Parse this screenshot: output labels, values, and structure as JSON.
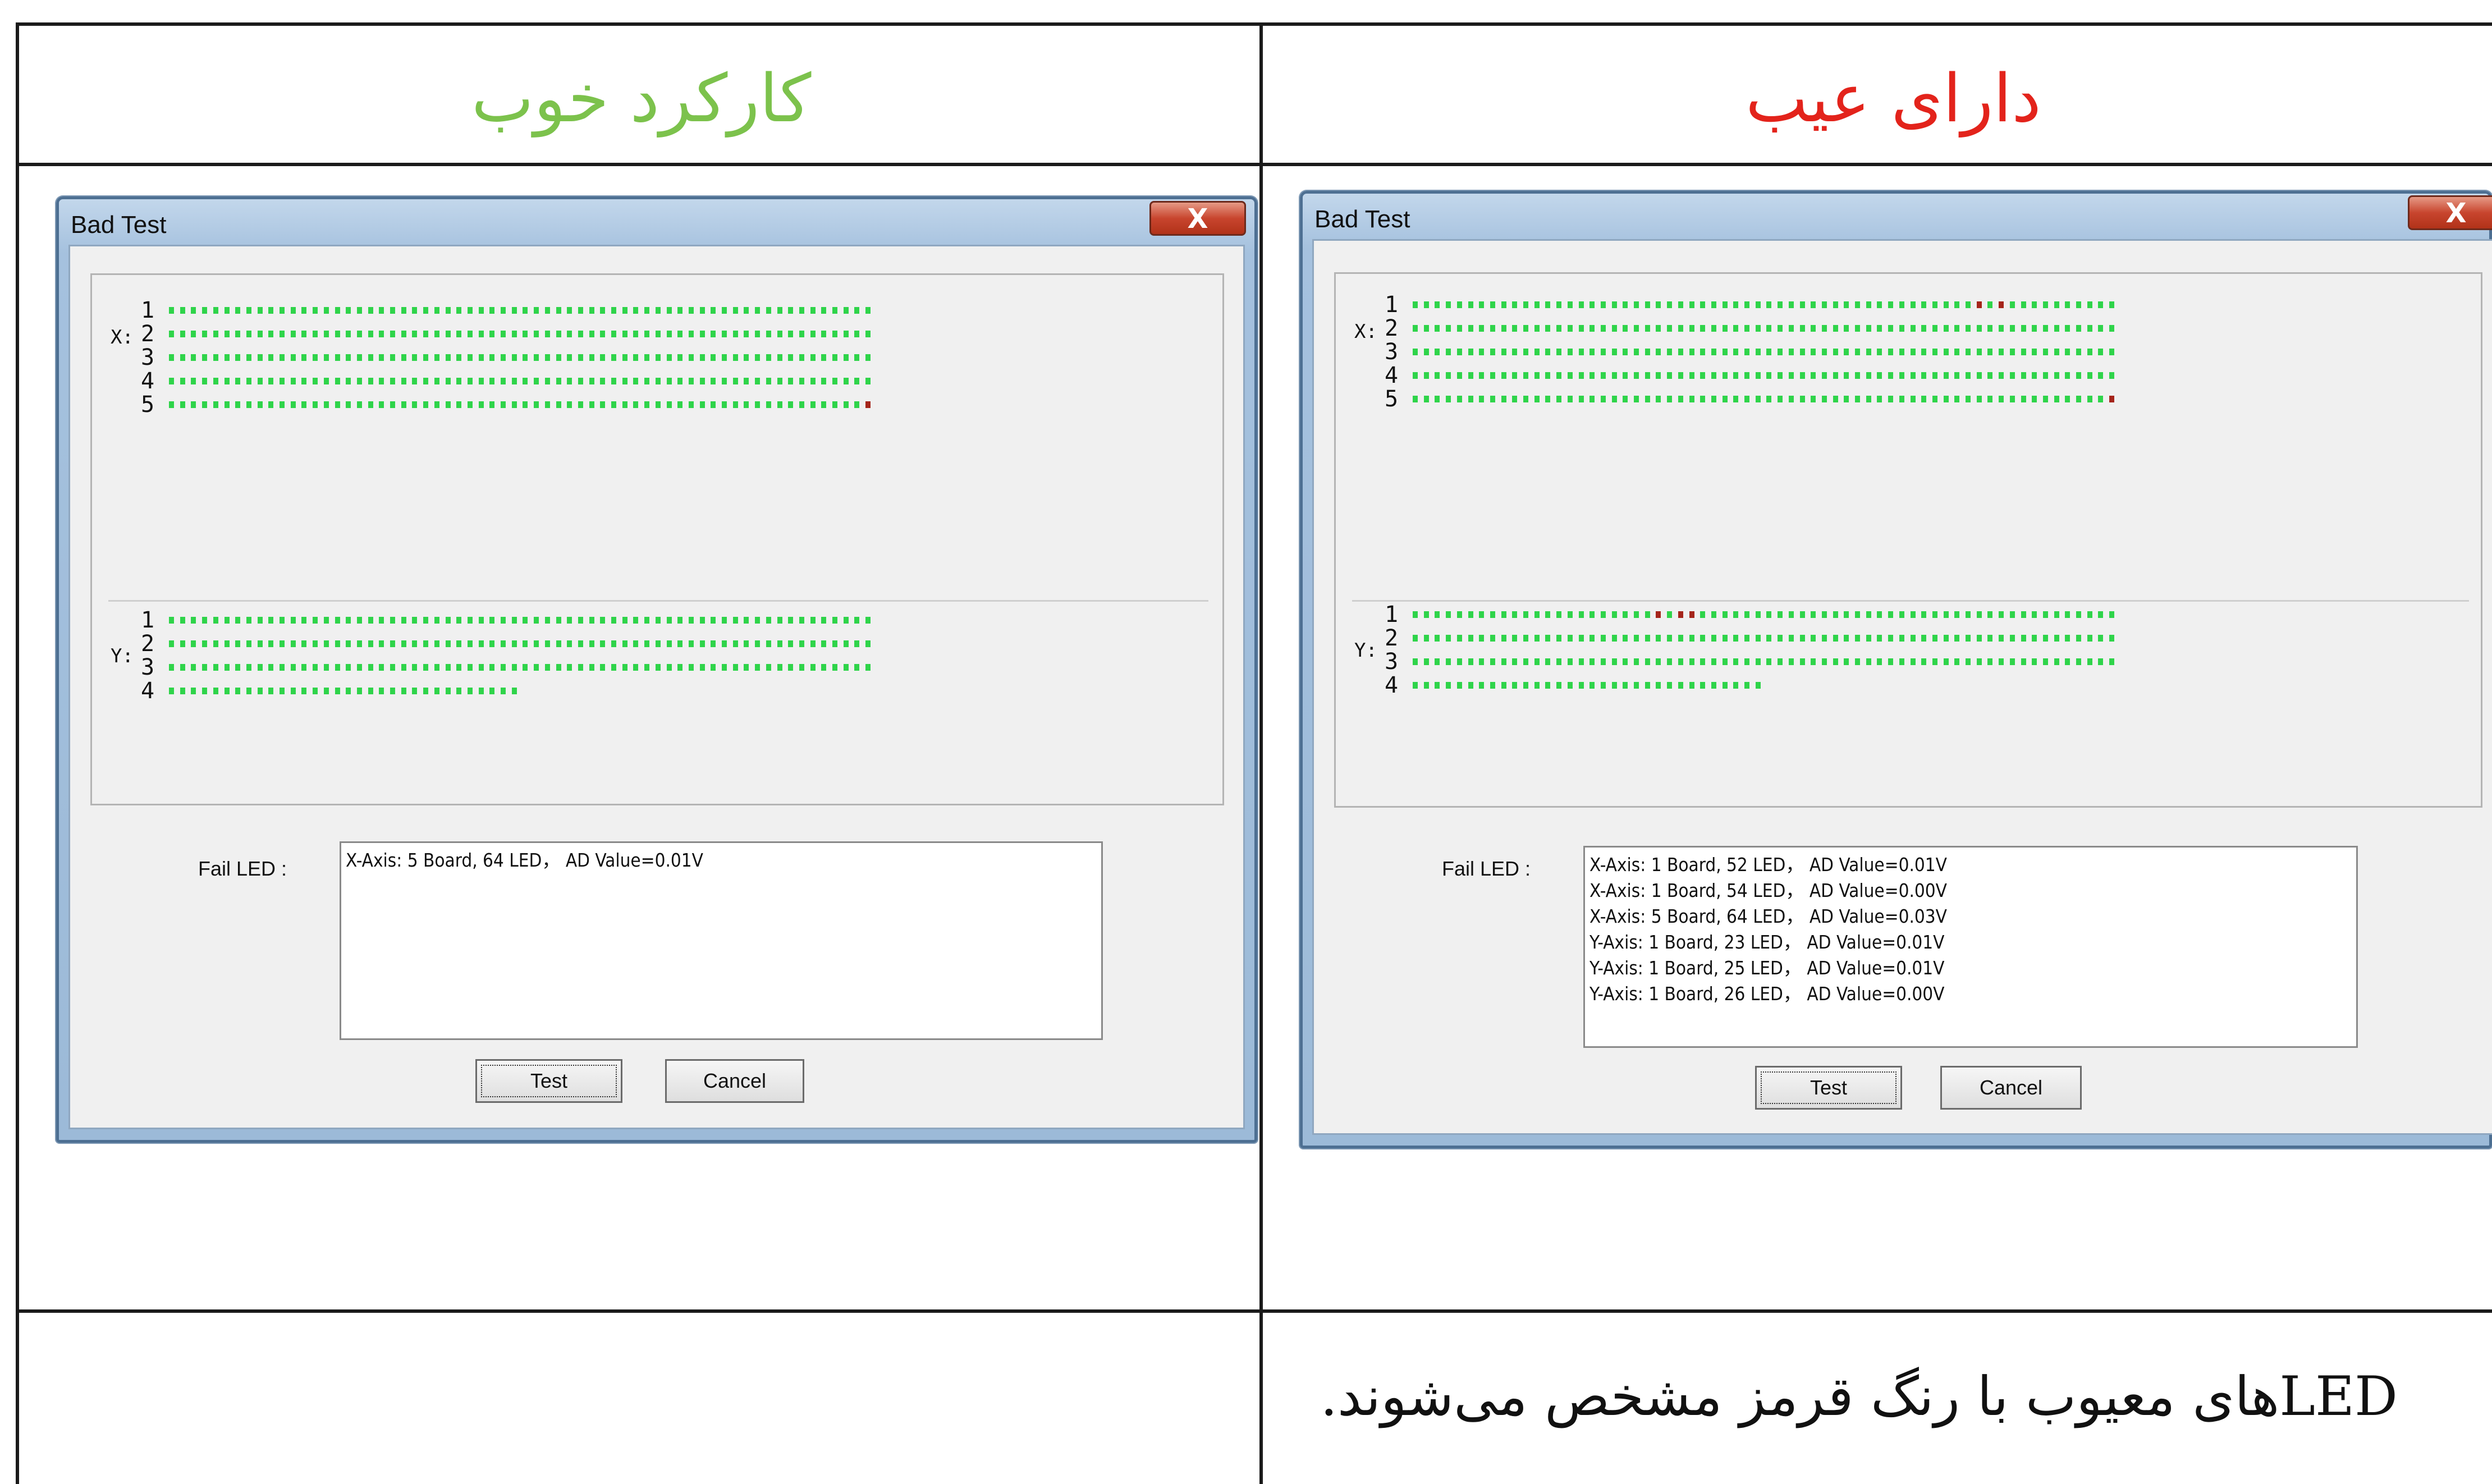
{
  "table": {
    "good_heading": "کارکرد خوب",
    "bad_heading": "دارای عیب",
    "note": "LEDهای معیوب با رنگ قرمز مشخص می‌شوند.",
    "colors": {
      "good_heading": "#7cc24c",
      "bad_heading": "#e3231b"
    }
  },
  "left_window": {
    "title": "Bad Test",
    "close_label": "X",
    "x_axis_label": "X:",
    "y_axis_label": "Y:",
    "x_rows": [
      {
        "label": "1",
        "count": 64,
        "bad": []
      },
      {
        "label": "2",
        "count": 64,
        "bad": []
      },
      {
        "label": "3",
        "count": 64,
        "bad": []
      },
      {
        "label": "4",
        "count": 64,
        "bad": []
      },
      {
        "label": "5",
        "count": 64,
        "bad": [
          64
        ]
      }
    ],
    "y_rows": [
      {
        "label": "1",
        "count": 64,
        "bad": []
      },
      {
        "label": "2",
        "count": 64,
        "bad": []
      },
      {
        "label": "3",
        "count": 64,
        "bad": []
      },
      {
        "label": "4",
        "count": 32,
        "bad": []
      }
    ],
    "fail_label": "Fail LED :",
    "fail_lines": [
      "X-Axis: 5 Board, 64 LED， AD Value=0.01V"
    ],
    "test_button": "Test",
    "cancel_button": "Cancel"
  },
  "right_window": {
    "title": "Bad Test",
    "close_label": "X",
    "x_axis_label": "X:",
    "y_axis_label": "Y:",
    "x_rows": [
      {
        "label": "1",
        "count": 64,
        "bad": [
          52,
          54
        ]
      },
      {
        "label": "2",
        "count": 64,
        "bad": []
      },
      {
        "label": "3",
        "count": 64,
        "bad": []
      },
      {
        "label": "4",
        "count": 64,
        "bad": []
      },
      {
        "label": "5",
        "count": 64,
        "bad": [
          64
        ]
      }
    ],
    "y_rows": [
      {
        "label": "1",
        "count": 64,
        "bad": [
          23,
          25,
          26
        ]
      },
      {
        "label": "2",
        "count": 64,
        "bad": []
      },
      {
        "label": "3",
        "count": 64,
        "bad": []
      },
      {
        "label": "4",
        "count": 32,
        "bad": []
      }
    ],
    "fail_label": "Fail LED :",
    "fail_lines": [
      "X-Axis: 1 Board, 52 LED， AD Value=0.01V",
      "X-Axis: 1 Board, 54 LED， AD Value=0.00V",
      "X-Axis: 5 Board, 64 LED， AD Value=0.03V",
      "Y-Axis: 1 Board, 23 LED， AD Value=0.01V",
      "Y-Axis: 1 Board, 25 LED， AD Value=0.01V",
      "Y-Axis: 1 Board, 26 LED， AD Value=0.00V"
    ],
    "test_button": "Test",
    "cancel_button": "Cancel"
  }
}
